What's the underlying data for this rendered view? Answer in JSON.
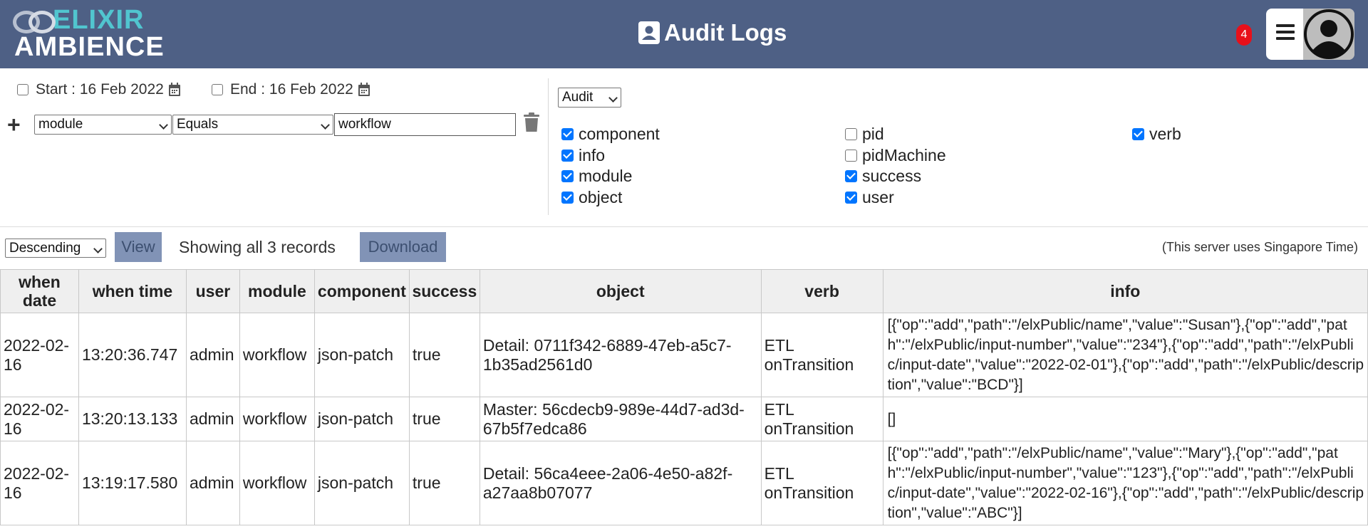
{
  "app": {
    "logo_top": "ELIXIR",
    "logo_bottom": "AMBIENCE",
    "title": "Audit Logs",
    "notification_count": "4",
    "colors": {
      "header_bg": "#4e6085",
      "accent": "#51c5cf",
      "badge": "#e8101a",
      "button_bg": "#8193b6"
    }
  },
  "filters": {
    "start_label": "Start :",
    "start_date": "16 Feb 2022",
    "end_label": "End :",
    "end_date": "16 Feb 2022",
    "field_select": "module",
    "operator_select": "Equals",
    "value_input": "workflow",
    "log_type_select": "Audit"
  },
  "fields": [
    {
      "name": "component",
      "checked": true
    },
    {
      "name": "info",
      "checked": true
    },
    {
      "name": "module",
      "checked": true
    },
    {
      "name": "object",
      "checked": true
    },
    {
      "name": "pid",
      "checked": false
    },
    {
      "name": "pidMachine",
      "checked": false
    },
    {
      "name": "success",
      "checked": true
    },
    {
      "name": "user",
      "checked": true
    },
    {
      "name": "verb",
      "checked": true
    }
  ],
  "toolbar": {
    "order_select": "Descending",
    "view_label": "View",
    "records_text": "Showing all 3 records",
    "download_label": "Download",
    "server_note": "(This server uses Singapore Time)"
  },
  "table": {
    "headers": [
      "when date",
      "when time",
      "user",
      "module",
      "component",
      "success",
      "object",
      "verb",
      "info"
    ],
    "rows": [
      [
        "2022-02-16",
        "13:20:36.747",
        "admin",
        "workflow",
        "json-patch",
        "true",
        "Detail: 0711f342-6889-47eb-a5c7-1b35ad2561d0",
        "ETL onTransition",
        "[{\"op\":\"add\",\"path\":\"/elxPublic/name\",\"value\":\"Susan\"},{\"op\":\"add\",\"path\":\"/elxPublic/input-number\",\"value\":\"234\"},{\"op\":\"add\",\"path\":\"/elxPublic/input-date\",\"value\":\"2022-02-01\"},{\"op\":\"add\",\"path\":\"/elxPublic/description\",\"value\":\"BCD\"}]"
      ],
      [
        "2022-02-16",
        "13:20:13.133",
        "admin",
        "workflow",
        "json-patch",
        "true",
        "Master: 56cdecb9-989e-44d7-ad3d-67b5f7edca86",
        "ETL onTransition",
        "[]"
      ],
      [
        "2022-02-16",
        "13:19:17.580",
        "admin",
        "workflow",
        "json-patch",
        "true",
        "Detail: 56ca4eee-2a06-4e50-a82f-a27aa8b07077",
        "ETL onTransition",
        "[{\"op\":\"add\",\"path\":\"/elxPublic/name\",\"value\":\"Mary\"},{\"op\":\"add\",\"path\":\"/elxPublic/input-number\",\"value\":\"123\"},{\"op\":\"add\",\"path\":\"/elxPublic/input-date\",\"value\":\"2022-02-16\"},{\"op\":\"add\",\"path\":\"/elxPublic/description\",\"value\":\"ABC\"}]"
      ]
    ]
  }
}
